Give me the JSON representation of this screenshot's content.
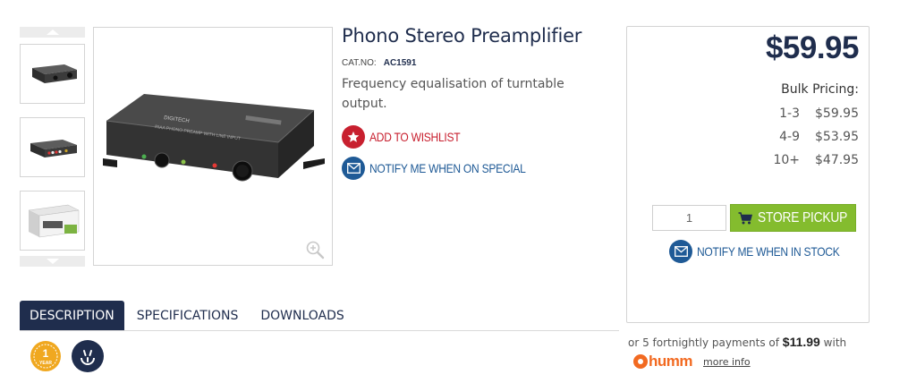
{
  "product": {
    "title": "Phono Stereo Preamplifier",
    "catno_label": "CAT.NO:",
    "catno_value": "AC1591",
    "description": "Frequency equalisation of turntable output."
  },
  "actions": {
    "wishlist_label": "ADD TO WISHLIST",
    "notify_special_label": "NOTIFY ME WHEN ON SPECIAL"
  },
  "pricing": {
    "price": "$59.95",
    "bulk_title": "Bulk Pricing:",
    "bulk_rows": [
      {
        "qty": "1-3",
        "price": "$59.95"
      },
      {
        "qty": "4-9",
        "price": "$53.95"
      },
      {
        "qty": "10+",
        "price": "$47.95"
      }
    ],
    "quantity_value": "1",
    "store_pickup_label": "STORE PICKUP",
    "notify_stock_label": "NOTIFY ME WHEN IN STOCK"
  },
  "humm": {
    "prefix": "or 5 fortnightly payments of",
    "amount": "$11.99",
    "suffix": "with",
    "logo_text": "humm",
    "more_info": "more info"
  },
  "tabs": [
    {
      "label": "DESCRIPTION",
      "active": true
    },
    {
      "label": "SPECIFICATIONS",
      "active": false
    },
    {
      "label": "DOWNLOADS",
      "active": false
    }
  ],
  "badges": {
    "warranty_number": "1",
    "warranty_unit": "YEAR"
  },
  "colors": {
    "navy": "#1f2d4d",
    "red": "#c8202f",
    "blue": "#1f5a96",
    "green": "#84bc2e",
    "humm_orange": "#f26a21",
    "warranty_gold": "#f0a820"
  },
  "icons": {
    "thumb_up": "chevron-up-icon",
    "thumb_down": "chevron-down-icon",
    "zoom": "zoom-in-icon",
    "wishlist": "star-icon",
    "notify": "envelope-icon",
    "cart": "cart-icon",
    "plug": "australian-plug-icon"
  }
}
